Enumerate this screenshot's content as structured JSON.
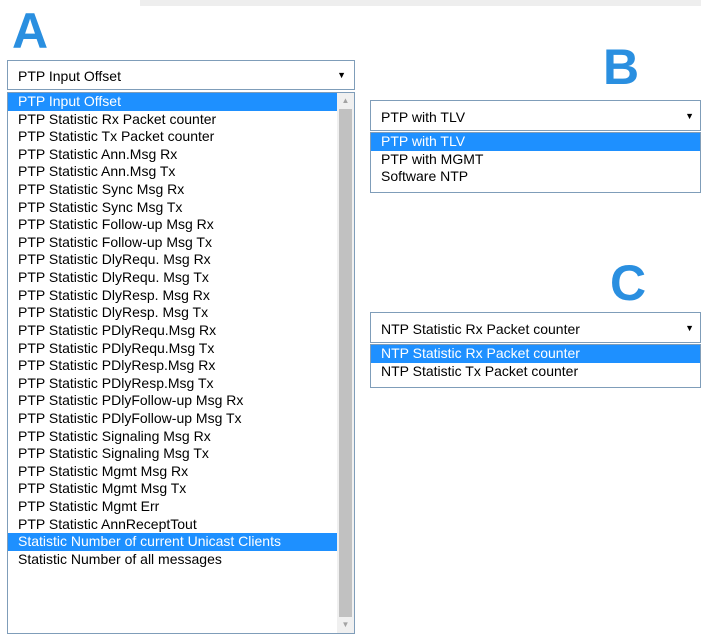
{
  "labels": {
    "a": "A",
    "b": "B",
    "c": "C"
  },
  "select_a": {
    "selected": "PTP Input Offset",
    "options": [
      "PTP Input Offset",
      "PTP Statistic Rx Packet counter",
      "PTP Statistic Tx Packet counter",
      "PTP Statistic Ann.Msg Rx",
      "PTP Statistic Ann.Msg Tx",
      "PTP Statistic Sync Msg Rx",
      "PTP Statistic Sync Msg Tx",
      "PTP Statistic Follow-up Msg Rx",
      "PTP Statistic Follow-up Msg Tx",
      "PTP Statistic DlyRequ. Msg Rx",
      "PTP Statistic DlyRequ. Msg Tx",
      "PTP Statistic DlyResp. Msg Rx",
      "PTP Statistic DlyResp. Msg Tx",
      "PTP Statistic PDlyRequ.Msg Rx",
      "PTP Statistic PDlyRequ.Msg Tx",
      "PTP Statistic PDlyResp.Msg Rx",
      "PTP Statistic PDlyResp.Msg Tx",
      "PTP Statistic PDlyFollow-up Msg Rx",
      "PTP Statistic PDlyFollow-up Msg Tx",
      "PTP Statistic Signaling Msg Rx",
      "PTP Statistic Signaling Msg Tx",
      "PTP Statistic Mgmt Msg Rx",
      "PTP Statistic Mgmt Msg Tx",
      "PTP Statistic Mgmt Err",
      "PTP Statistic AnnReceptTout",
      "Statistic Number of current Unicast Clients",
      "Statistic Number of all messages"
    ],
    "highlighted": [
      0,
      25
    ]
  },
  "select_b": {
    "selected": "PTP with TLV",
    "options": [
      "PTP with TLV",
      "PTP with MGMT",
      "Software NTP"
    ],
    "highlighted": [
      0
    ]
  },
  "select_c": {
    "selected": "NTP Statistic Rx Packet counter",
    "options": [
      "NTP Statistic Rx Packet counter",
      "NTP Statistic Tx Packet counter"
    ],
    "highlighted": [
      0
    ]
  },
  "icons": {
    "dropdown_arrow": "▼",
    "scroll_up": "▲",
    "scroll_down": "▼"
  },
  "colors": {
    "label": "#2a8fe0",
    "highlight": "#1e90ff"
  }
}
